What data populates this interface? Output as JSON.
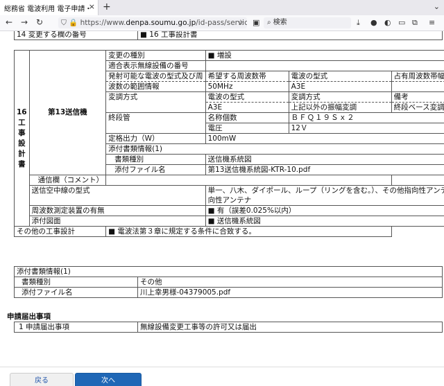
{
  "browser": {
    "tab_title": "総務省 電波利用 電子申請・",
    "tab_close": "×",
    "new_tab": "+",
    "url_prefix": "https://www.",
    "url_host": "denpa.soumu.go.jp",
    "url_rest": "/id-pass/service",
    "search_placeholder": "検索"
  },
  "header_row": {
    "label": "14 変更する欄の番号",
    "value": "■ 16 工事設計書"
  },
  "section16": {
    "side_label": "16工事設計書",
    "sub_label": "第13送信機",
    "change_type": {
      "label": "変更の種別",
      "value": "■ 増設"
    },
    "display_label": "適合表示無線設備の番号",
    "emission": {
      "label1": "発射可能な電波の型式及び周",
      "label2": "波数の範囲情報",
      "h1": "希望する周波数帯",
      "h2": "電波の型式",
      "h3": "占有周波数帯幅",
      "v1": "50MHz",
      "v2": "A3E",
      "v3": ""
    },
    "modulation": {
      "label": "変調方式",
      "h1": "電波の型式",
      "h2": "変調方式",
      "h3": "備考",
      "v1": "A3E",
      "v2": "上記以外の振幅変調",
      "v3": "終段ベース変調"
    },
    "final_stage": {
      "label": "終段管",
      "name_label": "名称個数",
      "name_value": "ＢＦＱ１９Ｓｘ２",
      "voltage_label": "電圧",
      "voltage_value": "12Ｖ"
    },
    "rated_output": {
      "label": "定格出力（W）",
      "value": "100mW"
    },
    "attach": {
      "label": "添付書類情報(1)",
      "type_label": "書類種別",
      "type_value": "送信機系統図",
      "file_label": "添付ファイル名",
      "file_value": "第13送信機系統図-KTR-10.pdf",
      "comment_label": "通信欄（コメント）",
      "comment_value": ""
    },
    "antenna": {
      "label": "送信空中線の型式",
      "value1": "単一、八木、ダイポール、ループ（リングを含む。）、その他指向性アンテナ、その他無指",
      "value2": "向性アンテナ"
    },
    "freq_measure": {
      "label": "周波数測定装置の有無",
      "value": "■ 有（誤差0.025%以内）"
    },
    "attach_drawing": {
      "label": "添付図面",
      "value": "■ 送信機系統図"
    },
    "other_design": {
      "label": "その他の工事設計",
      "value": "■ 電波法第３章に規定する条件に合致する。"
    }
  },
  "attach2": {
    "header": "添付書類情報(1)",
    "type_label": "書類種別",
    "type_value": "その他",
    "file_label": "添付ファイル名",
    "file_value": "川上幸男様-04379005.pdf"
  },
  "application": {
    "section_title": "申請届出事項",
    "row_label": "1 申請届出事項",
    "row_value": "無線設備変更工事等の許可又は届出"
  },
  "buttons": {
    "back": "戻る",
    "next": "次へ"
  }
}
